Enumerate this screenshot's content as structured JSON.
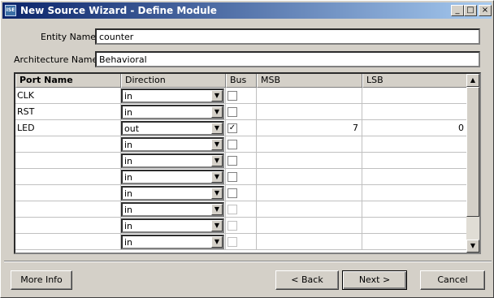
{
  "window": {
    "title": "New Source Wizard - Define Module",
    "icon_text": "ISE",
    "controls": {
      "minimize": "_",
      "maximize": "□",
      "close": "×"
    }
  },
  "form": {
    "entity_label": "Entity Name",
    "entity_value": "counter",
    "arch_label": "Architecture Name",
    "arch_value": "Behavioral"
  },
  "grid": {
    "headers": [
      "Port Name",
      "Direction",
      "Bus",
      "MSB",
      "LSB"
    ],
    "rows": [
      {
        "name": "CLK",
        "direction": "in",
        "bus": false,
        "msb": "",
        "lsb": ""
      },
      {
        "name": "RST",
        "direction": "in",
        "bus": false,
        "msb": "",
        "lsb": ""
      },
      {
        "name": "LED",
        "direction": "out",
        "bus": true,
        "msb": "7",
        "lsb": "0"
      },
      {
        "name": "",
        "direction": "in",
        "bus": false,
        "msb": "",
        "lsb": ""
      },
      {
        "name": "",
        "direction": "in",
        "bus": false,
        "msb": "",
        "lsb": ""
      },
      {
        "name": "",
        "direction": "in",
        "bus": false,
        "msb": "",
        "lsb": ""
      },
      {
        "name": "",
        "direction": "in",
        "bus": false,
        "msb": "",
        "lsb": ""
      },
      {
        "name": "",
        "direction": "in",
        "bus": false,
        "msb": "",
        "lsb": ""
      },
      {
        "name": "",
        "direction": "in",
        "bus": false,
        "msb": "",
        "lsb": ""
      },
      {
        "name": "",
        "direction": "in",
        "bus": false,
        "msb": "",
        "lsb": ""
      }
    ],
    "scroll_up": "▲",
    "scroll_down": "▼",
    "dropdown_arrow": "▼",
    "check_mark": "✓"
  },
  "buttons": {
    "more_info": "More Info",
    "back": "< Back",
    "next": "Next >",
    "cancel": "Cancel"
  }
}
